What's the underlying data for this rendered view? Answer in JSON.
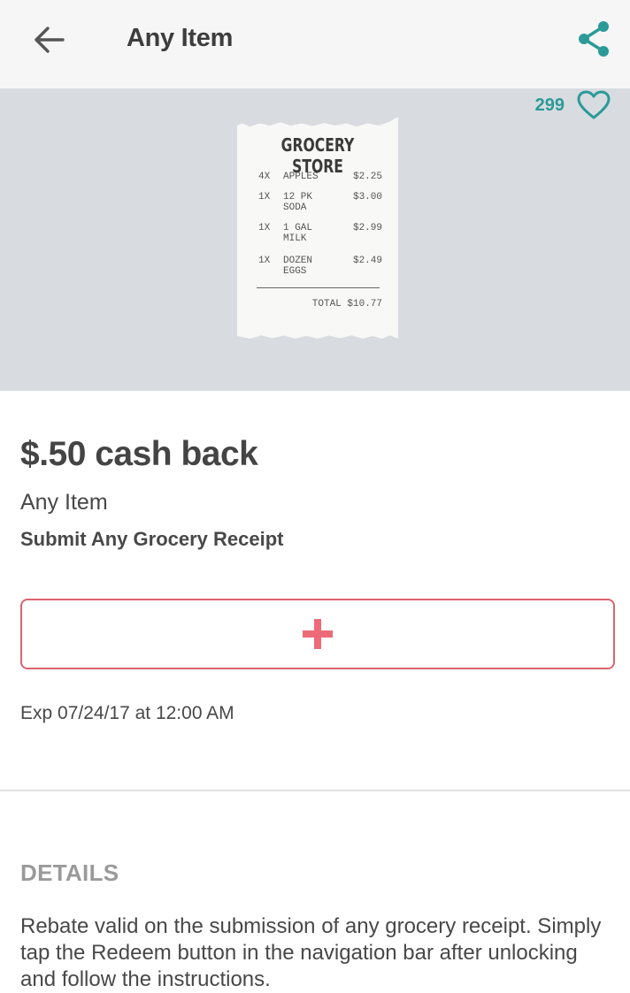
{
  "appbar": {
    "title": "Any Item",
    "back_icon": "arrow-left-icon",
    "share_icon": "share-icon"
  },
  "hero": {
    "like_count": "299",
    "like_icon": "heart-outline-icon",
    "receipt": {
      "store": "GROCERY STORE",
      "lines": [
        {
          "qty": "4X",
          "name": "APPLES",
          "price": "$2.25"
        },
        {
          "qty": "1X",
          "name": "12 PK SODA",
          "price": "$3.00"
        },
        {
          "qty": "1X",
          "name": "1 GAL MILK",
          "price": "$2.99"
        },
        {
          "qty": "1X",
          "name": "DOZEN EGGS",
          "price": "$2.49"
        }
      ],
      "total": "TOTAL $10.77"
    }
  },
  "offer": {
    "headline": "$.50 cash back",
    "item": "Any Item",
    "requirement": "Submit Any Grocery Receipt",
    "add_icon": "plus-icon",
    "expiration": "Exp 07/24/17 at 12:00 AM"
  },
  "details": {
    "heading": "DETAILS",
    "body": "Rebate valid on the submission of any grocery receipt. Simply tap the Redeem button in the navigation bar after unlocking and follow the instructions."
  },
  "colors": {
    "accent_teal": "#2c9a97",
    "accent_pink": "#ed6b78",
    "hero_bg": "#d8dce1"
  }
}
